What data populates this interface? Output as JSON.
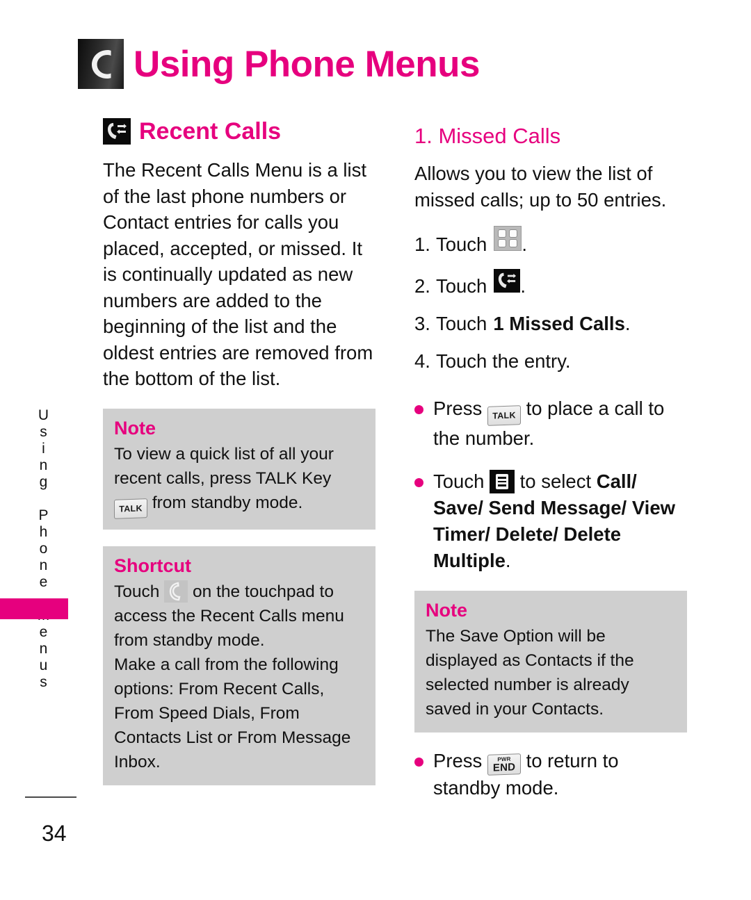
{
  "header": {
    "title": "Using Phone Menus",
    "icon": "phone-handset-icon"
  },
  "side_tab": {
    "label": "Using Phone Menus",
    "accent_color": "#e6007e"
  },
  "left_column": {
    "section": {
      "title": "Recent Calls",
      "icon": "recent-calls-icon"
    },
    "intro_paragraph": "The Recent Calls Menu is a list of the last phone numbers or Contact entries for calls you placed, accepted, or missed. It is continually updated as new numbers are added to the beginning of the list and the oldest entries are removed from the bottom of the list.",
    "note": {
      "title": "Note",
      "text_before_key": "To view a quick list of all your recent calls, press TALK Key",
      "key_label_line1": "TALK",
      "text_after_key": "from standby mode."
    },
    "shortcut": {
      "title": "Shortcut",
      "line1_before_icon": "Touch",
      "icon": "touchpad-call-icon",
      "line1_after_icon": "on the touchpad to access the Recent Calls menu from standby mode.",
      "line2": "Make a call from the following options: From Recent Calls, From Speed Dials, From Contacts List or From Message Inbox."
    }
  },
  "right_column": {
    "subsection_title": "1. Missed Calls",
    "description": "Allows you to view the list of missed calls; up to 50 entries.",
    "steps": [
      {
        "num": "1.",
        "before_icon": "Touch",
        "icon": "menu-grid-icon",
        "after_icon": "."
      },
      {
        "num": "2.",
        "before_icon": "Touch",
        "icon": "recent-calls-icon",
        "after_icon": "."
      },
      {
        "num": "3.",
        "before_icon": "Touch",
        "bold_text": "1 Missed Calls",
        "after_icon": "."
      },
      {
        "num": "4.",
        "before_icon": "Touch the entry.",
        "icon": null,
        "after_icon": ""
      }
    ],
    "bullets": [
      {
        "before_key": "Press",
        "key_label": "TALK",
        "key_type": "talk-key",
        "after_key": "to place a call to the number."
      },
      {
        "before_key": "Touch",
        "icon": "options-list-icon",
        "after_icon": "to select",
        "bold_text": "Call/ Save/ Send Message/ View Timer/ Delete/ Delete Multiple",
        "trailing": "."
      },
      {
        "before_key": "Press",
        "key_label_top": "PWR",
        "key_label_bottom": "END",
        "key_type": "end-key",
        "after_key": "to return to standby mode."
      }
    ],
    "note": {
      "title": "Note",
      "text": "The Save Option will be displayed as Contacts if the selected number is already saved in your Contacts."
    }
  },
  "footer": {
    "page_number": "34"
  },
  "colors": {
    "accent_magenta": "#e6007e",
    "callout_gray": "#cfcfcf",
    "text_black": "#111111"
  }
}
